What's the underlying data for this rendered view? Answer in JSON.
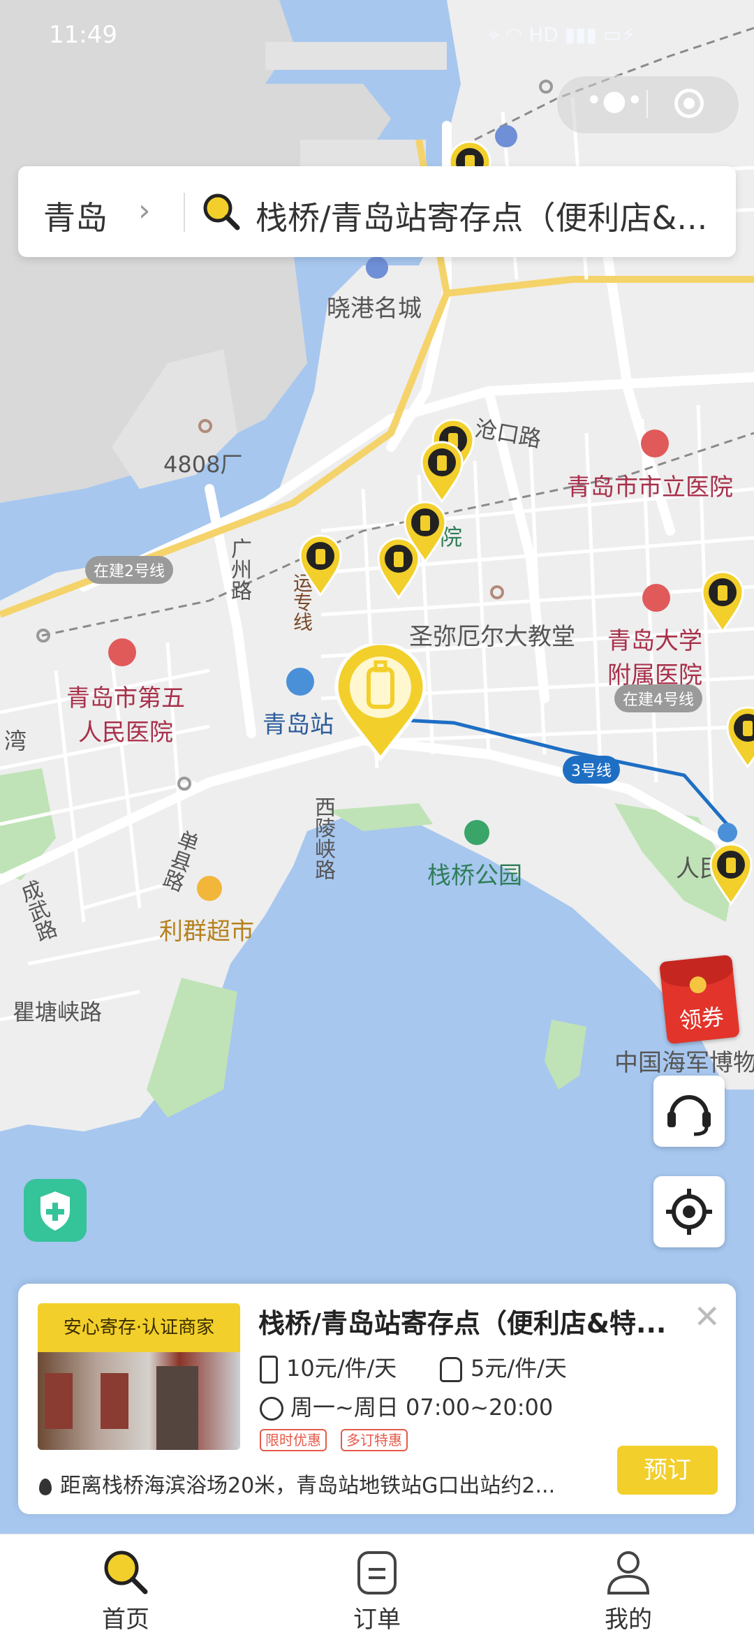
{
  "status_bar": {
    "time": "11:49",
    "network": "HD"
  },
  "search": {
    "city": "青岛",
    "query": "栈桥/青岛站寄存点（便利店&..."
  },
  "map_labels": {
    "xiaogang": "晓港名城",
    "cangkou": "沧口路",
    "city_hospital": "青岛市市立医院",
    "factory": "4808厂",
    "line2": "在建2号线",
    "guangzhou_rd": "广州路",
    "special_line": "运专线",
    "church": "圣弥厄尔大教堂",
    "uni_hospital": "青岛大学附属医院",
    "line4": "在建4号线",
    "fifth_hospital": "青岛市第五人民医院",
    "station": "青岛站",
    "line3": "3号线",
    "xiling": "西陵峡路",
    "shanxian": "单县路",
    "zhanqiao_park": "栈桥公园",
    "chengwu": "成武路",
    "liqun": "利群超市",
    "qutang": "瞿塘峡路",
    "navy": "中国海军博物",
    "renmin": "人民",
    "bay": "湾",
    "yuan": "院"
  },
  "coupon": {
    "label": "领券"
  },
  "card": {
    "badge": "安心寄存·认证商家",
    "title": "栈桥/青岛站寄存点（便利店&特...",
    "price_large": "10元/件/天",
    "price_small": "5元/件/天",
    "hours": "周一~周日 07:00~20:00",
    "tags": [
      "限时优惠",
      "多订特惠"
    ],
    "distance": "距离栈桥海滨浴场20米，青岛站地铁站G口出站约2...",
    "book_label": "预订"
  },
  "tabs": [
    {
      "label": "首页",
      "icon": "search-icon"
    },
    {
      "label": "订单",
      "icon": "order-icon"
    },
    {
      "label": "我的",
      "icon": "profile-icon"
    }
  ],
  "colors": {
    "accent": "#f2cf2a",
    "sea": "#a7c7ef",
    "land": "#eeeeee",
    "metro": "#1e6fc4"
  }
}
